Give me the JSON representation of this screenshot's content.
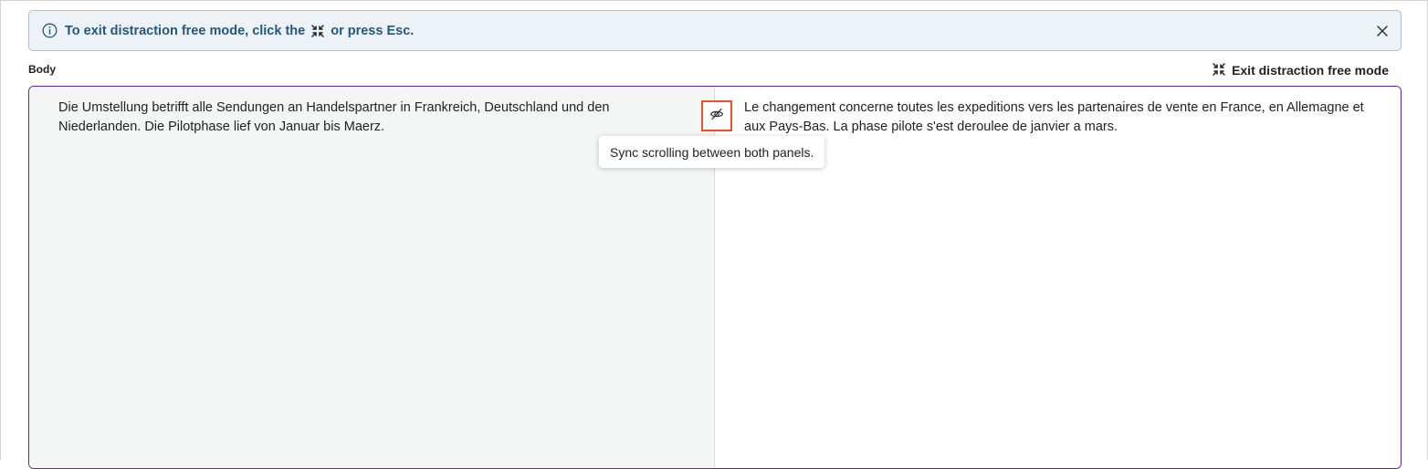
{
  "banner": {
    "text_before_icon": "To exit distraction free mode, click the",
    "text_after_icon": "or press Esc.",
    "info_icon": "info-circle-icon",
    "inline_icon": "collapse-arrows-icon",
    "close_icon": "close-icon",
    "colors": {
      "background": "#edf2f7",
      "border": "#a9c1d3",
      "text": "#22587e"
    }
  },
  "field": {
    "label": "Body",
    "exit_button_label": "Exit distraction free mode",
    "exit_button_icon": "collapse-arrows-icon"
  },
  "editor": {
    "source_text": "Die Umstellung betrifft alle Sendungen an Handelspartner in Frankreich, Deutschland und den Niederlanden. Die Pilotphase lief von Januar bis Maerz.",
    "target_text": "Le changement concerne toutes les expeditions vers les partenaires de vente en France, en Allemagne et aux Pays-Bas. La phase pilote s'est deroulee de janvier a mars.",
    "sync_button_icon": "eye-off-icon",
    "sync_tooltip": "Sync scrolling between both panels.",
    "colors": {
      "border": "#5a2a9a",
      "left_pane": "#f4f5f5",
      "highlight": "#f04e23"
    }
  }
}
